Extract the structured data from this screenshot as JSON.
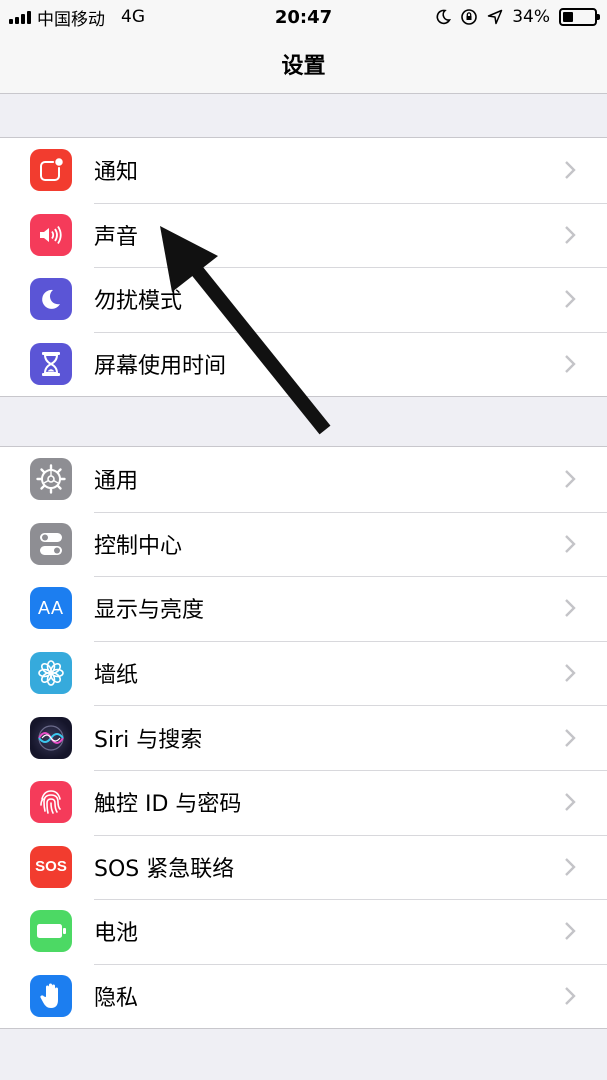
{
  "status_bar": {
    "carrier": "中国移动",
    "network": "4G",
    "time": "20:47",
    "battery_percent": "34%",
    "battery_level": 0.34
  },
  "nav": {
    "title": "设置"
  },
  "group1": [
    {
      "label": "通知",
      "icon": "notifications-icon",
      "color": "#f23c2f"
    },
    {
      "label": "声音",
      "icon": "sound-icon",
      "color": "#f53b5a"
    },
    {
      "label": "勿扰模式",
      "icon": "moon-icon",
      "color": "#5b55d6"
    },
    {
      "label": "屏幕使用时间",
      "icon": "hourglass-icon",
      "color": "#5b55d6"
    }
  ],
  "group2": [
    {
      "label": "通用",
      "icon": "gear-icon",
      "color": "#8e8e93"
    },
    {
      "label": "控制中心",
      "icon": "toggles-icon",
      "color": "#8e8e93"
    },
    {
      "label": "显示与亮度",
      "icon": "display-icon",
      "color": "#1c7ef0",
      "icon_text": "AA"
    },
    {
      "label": "墙纸",
      "icon": "wallpaper-icon",
      "color": "#36aadc"
    },
    {
      "label": "Siri 与搜索",
      "icon": "siri-icon",
      "color": "#222233"
    },
    {
      "label": "触控 ID 与密码",
      "icon": "fingerprint-icon",
      "color": "#f53b5a"
    },
    {
      "label": "SOS 紧急联络",
      "icon": "sos-icon",
      "color": "#f23c2f",
      "icon_text": "SOS"
    },
    {
      "label": "电池",
      "icon": "battery-icon",
      "color": "#4cd964"
    },
    {
      "label": "隐私",
      "icon": "hand-icon",
      "color": "#1c7ef0"
    }
  ]
}
